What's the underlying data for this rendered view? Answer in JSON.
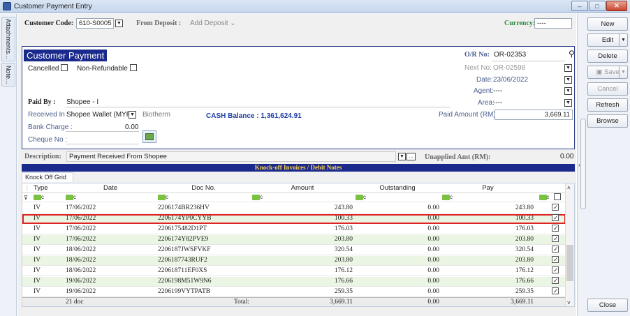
{
  "window": {
    "title": "Customer Payment Entry",
    "min": "–",
    "max": "□",
    "close": "✕"
  },
  "left_tabs": [
    "Attachments...",
    "Note..."
  ],
  "header": {
    "customer_code_label": "Customer Code:",
    "customer_code_value": "610-S0005",
    "from_deposit_label": "From Deposit :",
    "from_deposit_value": "Add Deposit",
    "currency_label": "Currency:",
    "currency_value": "----"
  },
  "panel": {
    "title": "Customer Payment",
    "cancelled_label": "Cancelled",
    "nonrefundable_label": "Non-Refundable",
    "or_no_label": "O/R No:",
    "or_no_value": "OR-02353",
    "next_no_label": "Next No:",
    "next_no_value": "OR-02598",
    "date_label": "Date:",
    "date_value": "23/06/2022",
    "agent_label": "Agent:",
    "agent_value": "----",
    "area_label": "Area:",
    "area_value": "----",
    "paid_by_label": "Paid By :",
    "paid_by_value": "Shopee - I",
    "received_in_label": "Received In :",
    "received_in_value": "Shopee Wallet (MYR)",
    "received_in_extra": "Biotherm",
    "cash_balance_label": "CASH Balance :",
    "cash_balance_value": "1,361,624.91",
    "paid_amount_label": "Paid Amount (RM):",
    "paid_amount_value": "3,669.11",
    "bank_charge_label": "Bank Charge :",
    "bank_charge_value": "0.00",
    "cheque_no_label": "Cheque No :"
  },
  "description": {
    "label": "Description:",
    "value": "Payment Received From Shopee",
    "ellipsis": "...",
    "unapplied_label": "Unapplied Amt (RM):",
    "unapplied_value": "0.00"
  },
  "grid": {
    "section_title": "Knock-off Invoices / Debit Notes",
    "tab_label": "Knock Off Grid",
    "columns": [
      "Type",
      "Date",
      "Doc No.",
      "Amount",
      "Outstanding",
      "Pay"
    ],
    "rows": [
      {
        "type": "IV",
        "date": "17/06/2022",
        "doc": "2206174BR236HV",
        "amount": "243.80",
        "outstanding": "0.00",
        "pay": "243.80"
      },
      {
        "type": "IV",
        "date": "17/06/2022",
        "doc": "2206174YP0CYYB",
        "amount": "100.33",
        "outstanding": "0.00",
        "pay": "100.33"
      },
      {
        "type": "IV",
        "date": "17/06/2022",
        "doc": "2206175482D1PT",
        "amount": "176.03",
        "outstanding": "0.00",
        "pay": "176.03"
      },
      {
        "type": "IV",
        "date": "17/06/2022",
        "doc": "2206174Y82PVE9",
        "amount": "203.80",
        "outstanding": "0.00",
        "pay": "203.80"
      },
      {
        "type": "IV",
        "date": "18/06/2022",
        "doc": "2206187JWSFVKF",
        "amount": "320.54",
        "outstanding": "0.00",
        "pay": "320.54"
      },
      {
        "type": "IV",
        "date": "18/06/2022",
        "doc": "2206187743RUF2",
        "amount": "203.80",
        "outstanding": "0.00",
        "pay": "203.80"
      },
      {
        "type": "IV",
        "date": "18/06/2022",
        "doc": "220618711EF0XS",
        "amount": "176.12",
        "outstanding": "0.00",
        "pay": "176.12"
      },
      {
        "type": "IV",
        "date": "19/06/2022",
        "doc": "2206198M51W9N6",
        "amount": "176.66",
        "outstanding": "0.00",
        "pay": "176.66"
      },
      {
        "type": "IV",
        "date": "19/06/2022",
        "doc": "2206199VYTPATB",
        "amount": "259.35",
        "outstanding": "0.00",
        "pay": "259.35"
      }
    ],
    "footer_count": "21 doc",
    "footer_total_label": "Total:",
    "footer_amount": "3,669.11",
    "footer_outstanding": "0.00",
    "footer_pay": "3,669.11"
  },
  "buttons": {
    "new": "New",
    "edit": "Edit",
    "delete": "Delete",
    "save": "Save",
    "cancel": "Cancel",
    "refresh": "Refresh",
    "browse": "Browse",
    "close": "Close"
  }
}
